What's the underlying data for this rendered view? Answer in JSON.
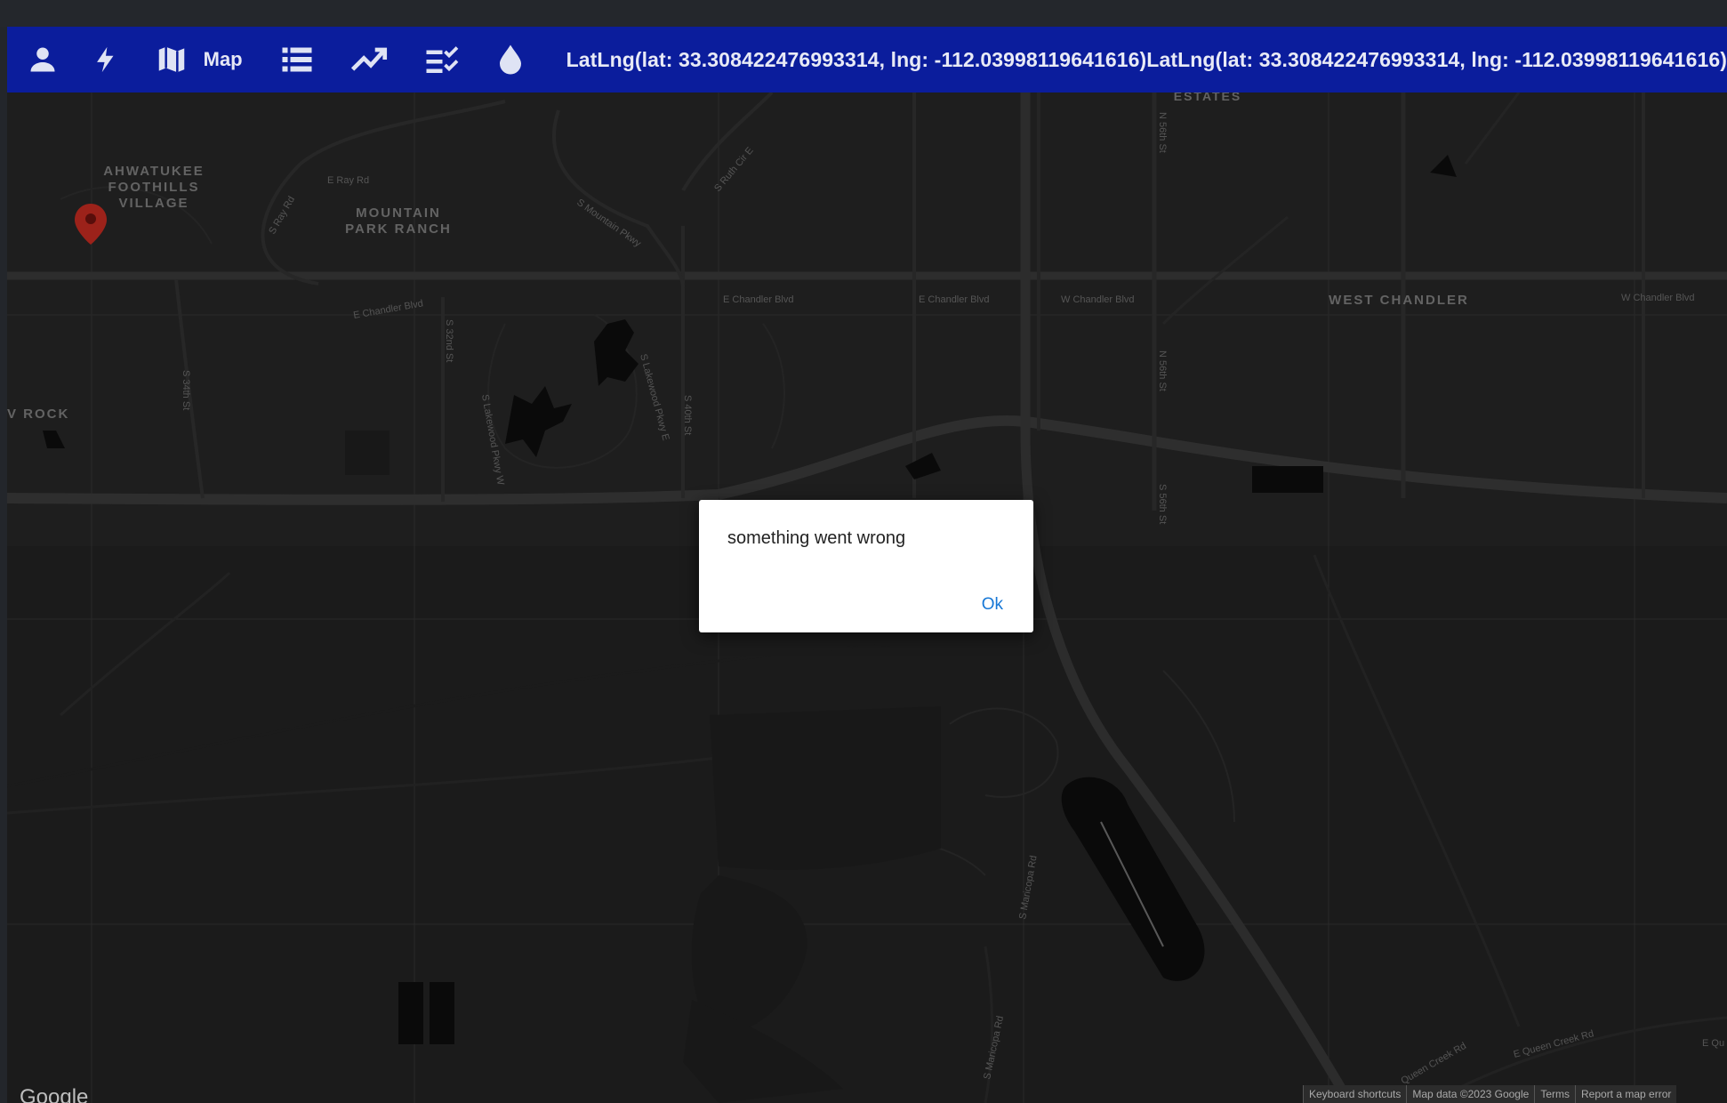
{
  "toolbar": {
    "map_label": "Map",
    "coordinates_text": "LatLng(lat: 33.308422476993314, lng: -112.03998119641616)LatLng(lat: 33.308422476993314, lng: -112.03998119641616)",
    "icons": [
      "user-icon",
      "bolt-icon",
      "map-icon",
      "list-icon",
      "trending-up-icon",
      "checklist-icon",
      "water-drop-icon"
    ],
    "background": "#0b1d9c"
  },
  "map": {
    "place_labels": {
      "ahwatukee_1": "AHWATUKEE",
      "ahwatukee_2": "FOOTHILLS",
      "ahwatukee_3": "VILLAGE",
      "mountain_1": "MOUNTAIN",
      "mountain_2": "PARK RANCH",
      "west_chandler": "WEST CHANDLER",
      "estates": "ESTATES",
      "rock": "V ROCK"
    },
    "street_labels": {
      "e_ray_rd": "E Ray Rd",
      "s_ray_rd": "S Ray Rd",
      "s_mountain_pkwy": "S Mountain Pkwy",
      "s_ruth_cir": "S Ruth Cir E",
      "e_chandler_1": "E Chandler Blvd",
      "e_chandler_2": "E Chandler Blvd",
      "e_chandler_3": "E Chandler Blvd",
      "w_chandler_1": "W Chandler Blvd",
      "w_chandler_2": "W Chandler Blvd",
      "s_34th": "S 34th St",
      "s_32nd": "S 32nd St",
      "s_40th": "S 40th St",
      "s_lakewood_1": "S Lakewood Pkwy E",
      "s_lakewood_2": "S Lakewood Pkwy W",
      "n_56th": "N 56th St",
      "s_56th": "S 56th St",
      "s_maricopa_1": "S Maricopa Rd",
      "s_maricopa_2": "S Maricopa Rd",
      "e_queen_creek": "E Queen Creek Rd",
      "queen_creek": "Queen Creek Rd",
      "e_qu": "E Qu"
    },
    "marker_icon": "map-pin-icon",
    "marker_color": "#d93025",
    "google_logo": "Google",
    "attribution": [
      "Keyboard shortcuts",
      "Map data ©2023 Google",
      "Terms",
      "Report a map error"
    ]
  },
  "dialog": {
    "message": "something went wrong",
    "ok_label": "Ok",
    "ok_color": "#1677d6"
  }
}
